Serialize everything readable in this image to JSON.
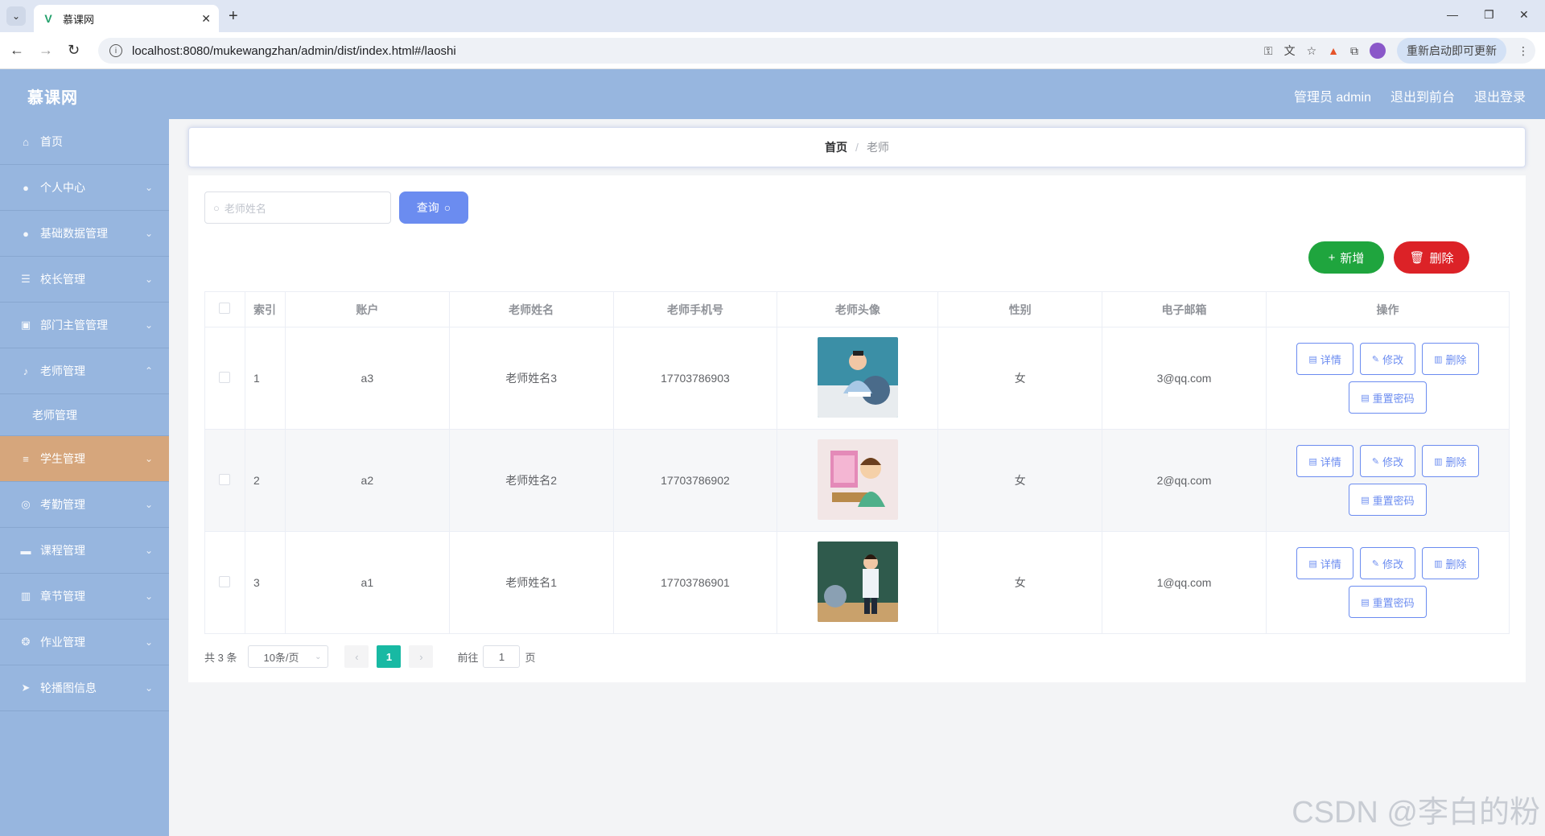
{
  "browser": {
    "tab_title": "慕课网",
    "url": "localhost:8080/mukewangzhan/admin/dist/index.html#/laoshi",
    "update_button": "重新启动即可更新"
  },
  "header": {
    "brand": "慕课网",
    "user": "管理员 admin",
    "to_front": "退出到前台",
    "logout": "退出登录"
  },
  "sidebar": {
    "items": [
      {
        "label": "首页",
        "icon": "home-icon"
      },
      {
        "label": "个人中心",
        "icon": "user-icon"
      },
      {
        "label": "基础数据管理",
        "icon": "user-icon"
      },
      {
        "label": "校长管理",
        "icon": "sliders-icon"
      },
      {
        "label": "部门主管管理",
        "icon": "clipboard-icon"
      },
      {
        "label": "老师管理",
        "icon": "microphone-icon"
      },
      {
        "label": "老师管理",
        "icon": ""
      },
      {
        "label": "学生管理",
        "icon": "menu-icon"
      },
      {
        "label": "考勤管理",
        "icon": "globe-icon"
      },
      {
        "label": "课程管理",
        "icon": "chat-icon"
      },
      {
        "label": "章节管理",
        "icon": "chart-icon"
      },
      {
        "label": "作业管理",
        "icon": "aperture-icon"
      },
      {
        "label": "轮播图信息",
        "icon": "send-icon"
      }
    ]
  },
  "breadcrumb": {
    "home": "首页",
    "separator": "/",
    "current": "老师"
  },
  "toolbar": {
    "search_placeholder": "老师姓名",
    "query_label": "查询",
    "add_label": "新增",
    "delete_label": "删除"
  },
  "table": {
    "headers": [
      "索引",
      "账户",
      "老师姓名",
      "老师手机号",
      "老师头像",
      "性别",
      "电子邮箱",
      "操作"
    ],
    "rows": [
      {
        "index": "1",
        "account": "a3",
        "name": "老师姓名3",
        "phone": "17703786903",
        "gender": "女",
        "email": "3@qq.com"
      },
      {
        "index": "2",
        "account": "a2",
        "name": "老师姓名2",
        "phone": "17703786902",
        "gender": "女",
        "email": "2@qq.com"
      },
      {
        "index": "3",
        "account": "a1",
        "name": "老师姓名1",
        "phone": "17703786901",
        "gender": "女",
        "email": "1@qq.com"
      }
    ],
    "ops": {
      "detail": "详情",
      "edit": "修改",
      "delete": "删除",
      "reset": "重置密码"
    }
  },
  "pagination": {
    "total": "共 3 条",
    "page_size": "10条/页",
    "current": "1",
    "goto_prefix": "前往",
    "goto_value": "1",
    "goto_suffix": "页"
  },
  "watermark": "CSDN @李白的粉",
  "colors": {
    "header_bg": "#97b6df",
    "active_menu": "#d6a67c",
    "primary": "#6b8cf0",
    "success": "#1fa53e",
    "danger": "#dc2227",
    "pager_active": "#18b9a3"
  }
}
